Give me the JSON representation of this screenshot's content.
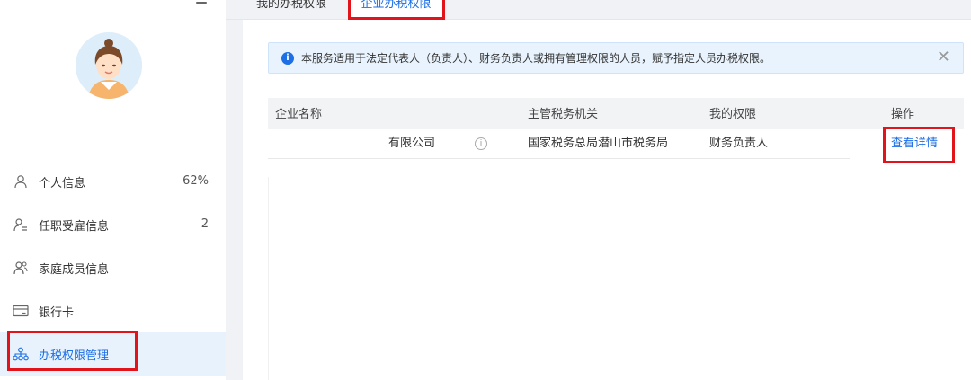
{
  "sidebar": {
    "menu_icon": "hamburger-menu-icon",
    "avatar_icon": "user-avatar",
    "items": [
      {
        "label": "个人信息",
        "value": "62%",
        "icon": "person-icon"
      },
      {
        "label": "任职受雇信息",
        "value": "2",
        "icon": "person-list-icon"
      },
      {
        "label": "家庭成员信息",
        "value": "",
        "icon": "family-icon"
      },
      {
        "label": "银行卡",
        "value": "",
        "icon": "bank-card-icon"
      },
      {
        "label": "办税权限管理",
        "value": "",
        "icon": "org-tree-icon",
        "active": true
      }
    ]
  },
  "tabs": [
    {
      "label": "我的办税权限"
    },
    {
      "label": "企业办税权限",
      "active": true
    }
  ],
  "notice": {
    "text": "本服务适用于法定代表人（负责人）、财务负责人或拥有管理权限的人员，赋予指定人员办税权限。",
    "icon": "info-icon",
    "close_icon": "close-icon"
  },
  "table": {
    "headers": [
      "企业名称",
      "主管税务机关",
      "我的权限",
      "操作"
    ],
    "rows": [
      {
        "company": "有限公司",
        "tax_authority": "国家税务总局潜山市税务局",
        "permission": "财务负责人",
        "action": "查看详情"
      }
    ]
  },
  "colors": {
    "accent": "#1c6fe6",
    "highlight": "#e0141a",
    "active_bg": "#e8f2fd",
    "notice_bg": "#e9f3fd"
  }
}
